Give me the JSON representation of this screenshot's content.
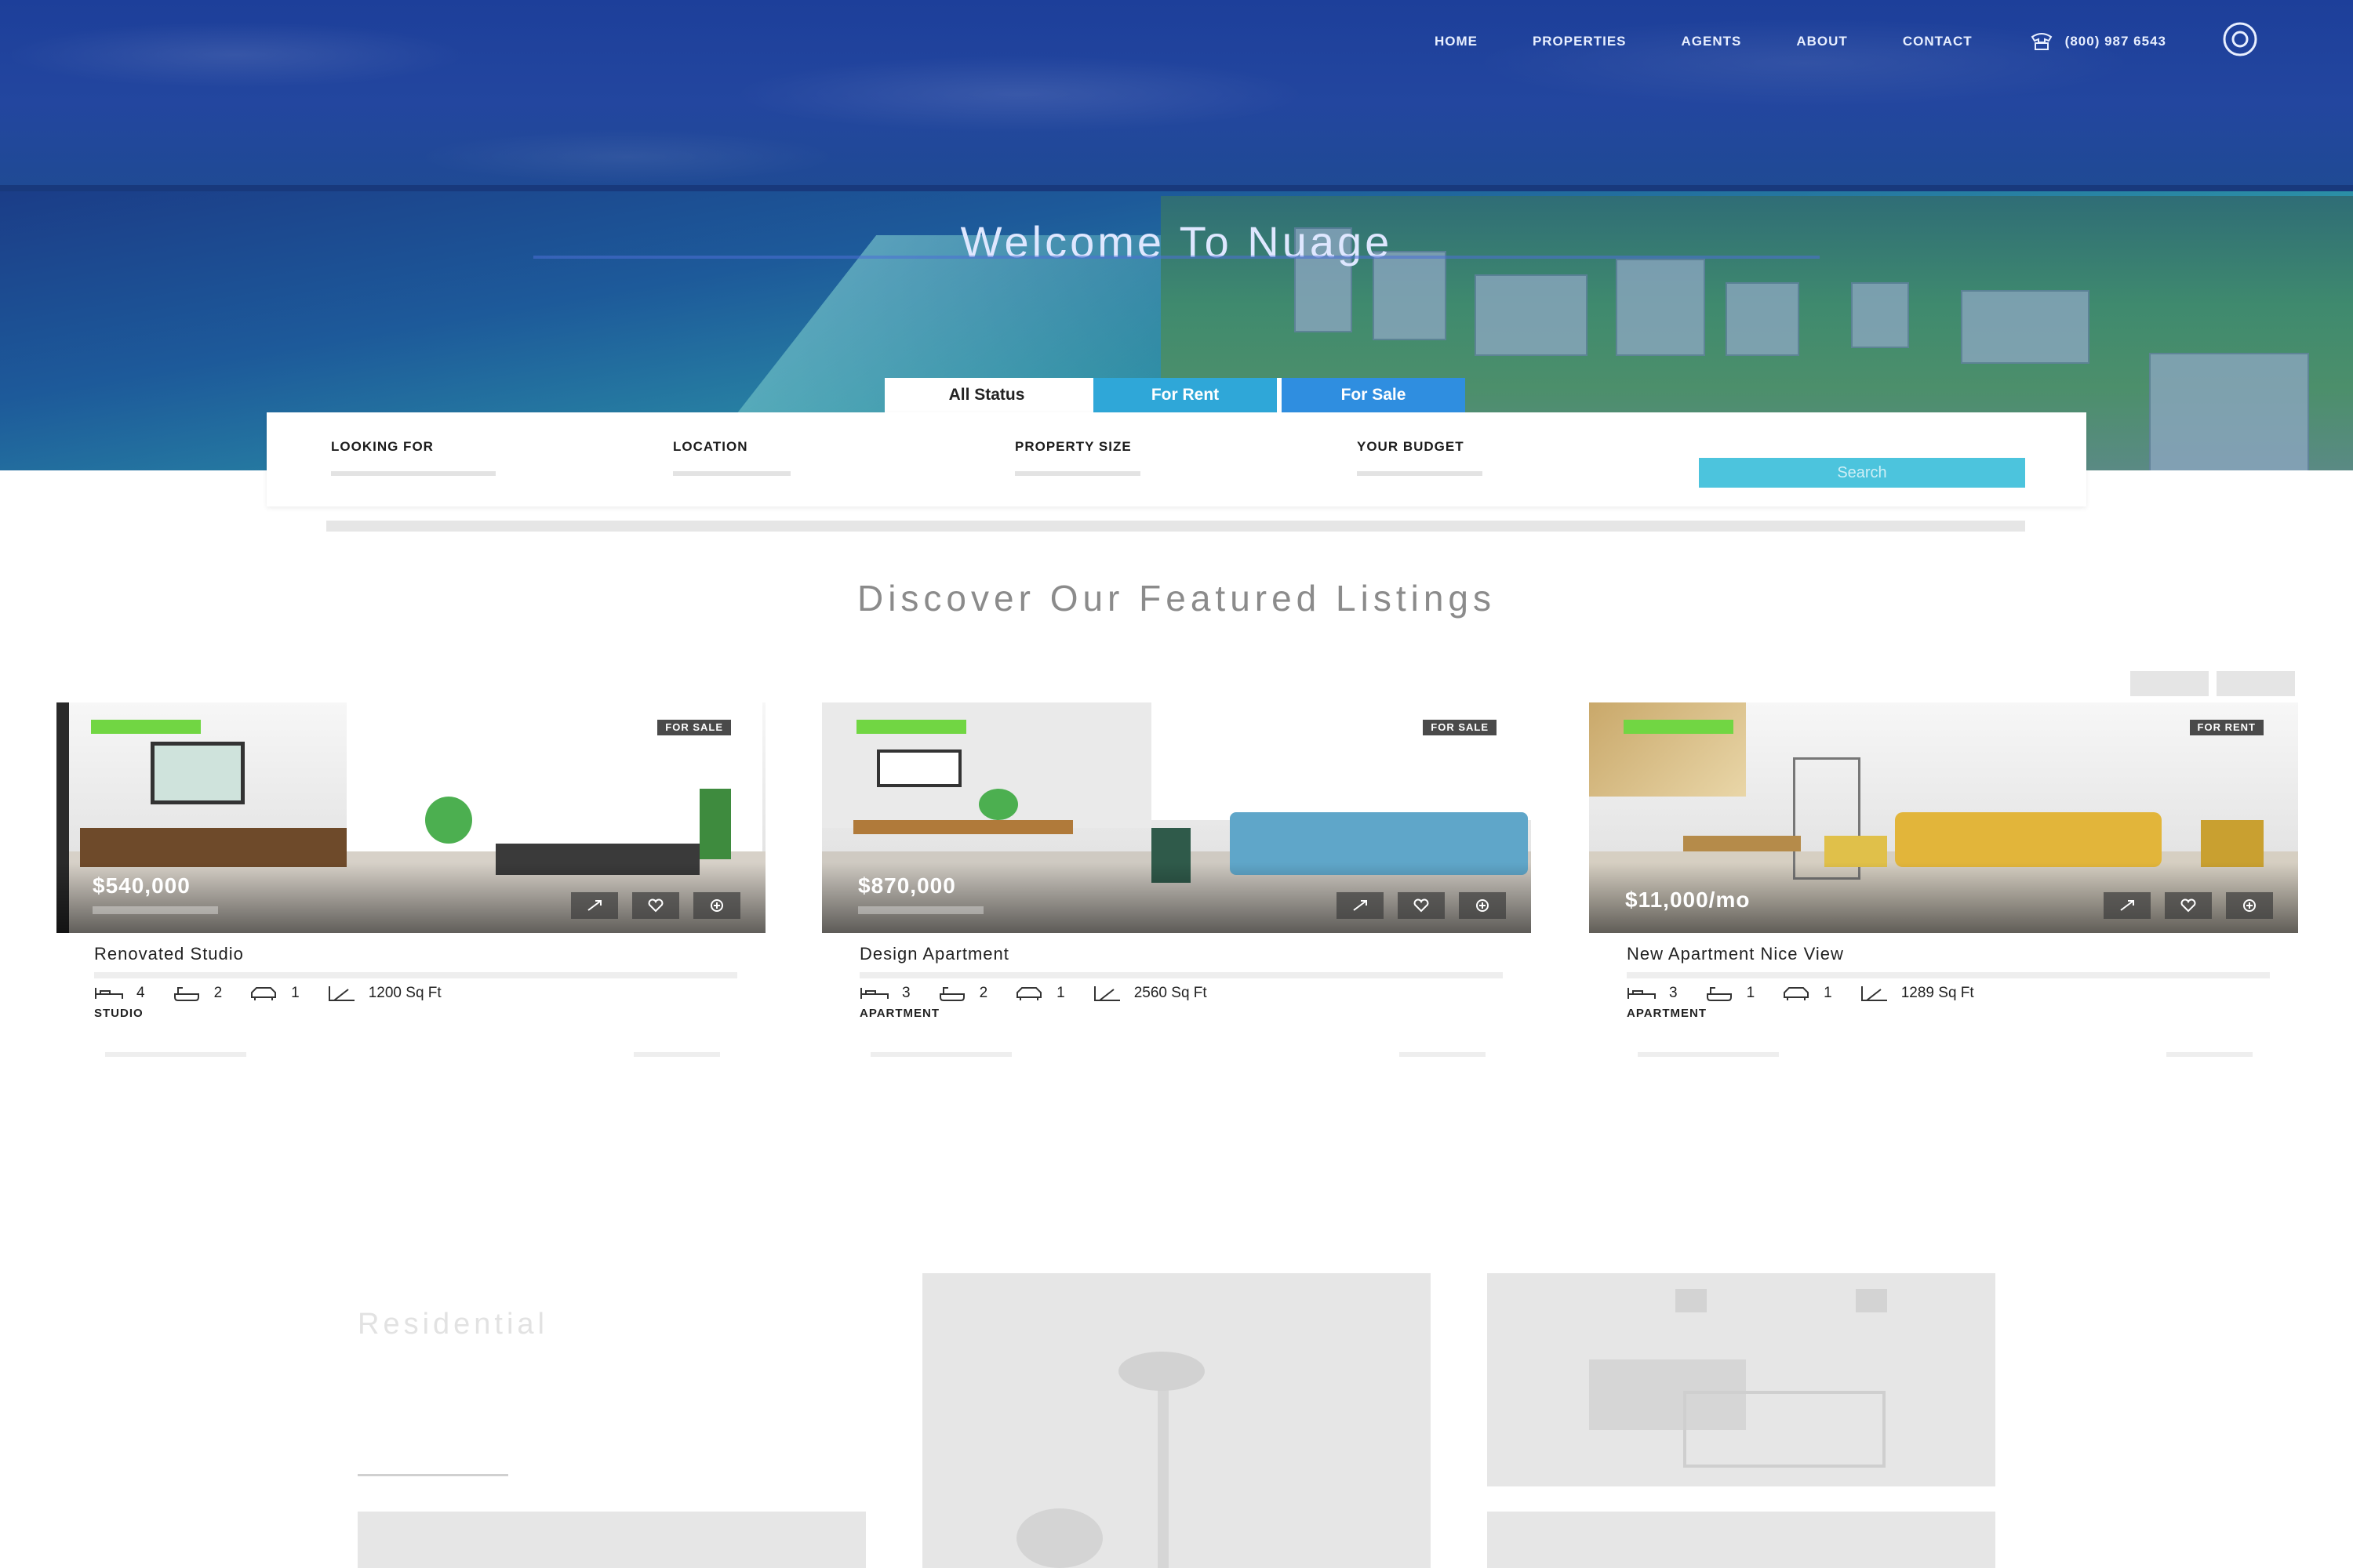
{
  "nav": {
    "items": [
      "HOME",
      "PROPERTIES",
      "AGENTS",
      "ABOUT",
      "CONTACT"
    ],
    "phone": "(800) 987 6543"
  },
  "hero": {
    "title": "Welcome To Nuage"
  },
  "search": {
    "tabs": [
      "All Status",
      "For Rent",
      "For Sale"
    ],
    "fields": [
      {
        "label": "LOOKING FOR"
      },
      {
        "label": "LOCATION"
      },
      {
        "label": "PROPERTY SIZE"
      },
      {
        "label": "YOUR BUDGET"
      }
    ],
    "button": "Search"
  },
  "featured": {
    "title": "Discover Our Featured Listings",
    "listings": [
      {
        "status": "FOR SALE",
        "price": "$540,000",
        "title": "Renovated Studio",
        "beds": "4",
        "baths": "2",
        "garages": "1",
        "area": "1200 Sq Ft",
        "type": "STUDIO"
      },
      {
        "status": "FOR SALE",
        "price": "$870,000",
        "title": "Design Apartment",
        "beds": "3",
        "baths": "2",
        "garages": "1",
        "area": "2560 Sq Ft",
        "type": "APARTMENT"
      },
      {
        "status": "FOR RENT",
        "price": "$11,000/mo",
        "title": "New Apartment Nice View",
        "beds": "3",
        "baths": "1",
        "garages": "1",
        "area": "1289 Sq Ft",
        "type": "APARTMENT"
      }
    ]
  },
  "categories": {
    "title": "Residential"
  },
  "colors": {
    "accent": "#4cc4dd",
    "featured_badge": "#71d643",
    "hero_blue": "#23469f"
  }
}
